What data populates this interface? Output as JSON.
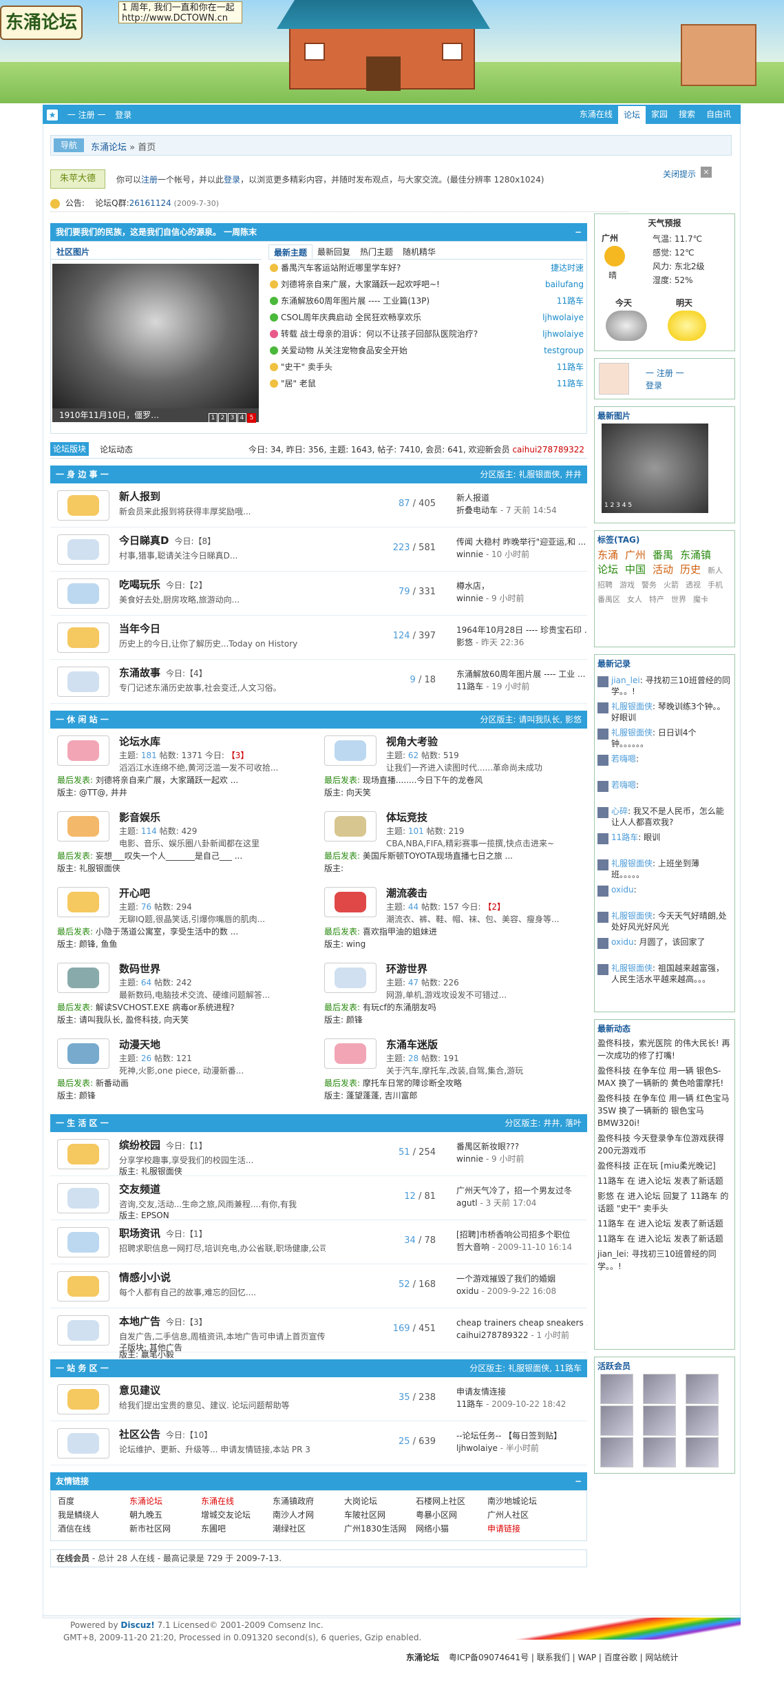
{
  "header": {
    "logo": "东涌论坛",
    "slogan_1": "1 周年, 我们一直和你在一起",
    "slogan_2": "http://www.DCTOWN.cn"
  },
  "nav": {
    "register": "一 注册 一",
    "login": "登录",
    "items": [
      "东涌在线",
      "论坛",
      "家园",
      "搜索",
      "自由讯"
    ]
  },
  "crumb": {
    "nav": "导航",
    "site": "东涌论坛",
    "arrow": "»",
    "home": "首页"
  },
  "welcome": {
    "hello": "朱苹大德",
    "prefix": "你可以",
    "register": "注册",
    "mid": "一个帐号，并以此",
    "login": "登录",
    "suffix": "，以浏览更多精彩内容，并随时发布观点，与大家交流。(最佳分辨率 1280x1024)",
    "close_tip": "关闭提示",
    "close_x": "×"
  },
  "notice": {
    "label": "公告:",
    "text": "论坛Q群:",
    "qq": "26161124",
    "date": "(2009-7-30)"
  },
  "slogan_bar": {
    "text": "我们要我们的民族，这是我们自信心的源泉。 一周陈末",
    "min": "−"
  },
  "photo": {
    "title": "社区图片",
    "caption": "1910年11月10日，僵罗…",
    "nums": [
      "1",
      "2",
      "3",
      "4",
      "5"
    ]
  },
  "thread_tabs": [
    "最新主题",
    "最新回复",
    "热门主题",
    "随机精华"
  ],
  "threads": [
    {
      "title": "番禺汽车客运站附近哪里学车好?",
      "author": "捷达时速"
    },
    {
      "title": "刘德将亲自来广展，大家踊跃一起欢呼吧~!",
      "author": "bailufang"
    },
    {
      "title": "东涌解放60周年图片展 ---- 工业篇(13P)",
      "author": "11路车"
    },
    {
      "title": "CSOL周年庆典启动 全民狂欢畅享欢乐",
      "author": "ljhwolaiye"
    },
    {
      "title": "转载 战士母亲的泪诉：何以不让孩子回部队医院治疗?",
      "author": "ljhwolaiye"
    },
    {
      "title": "关爱动物 从关注宠物食品安全开始",
      "author": "testgroup"
    },
    {
      "title": "\"史干\" 卖手头",
      "author": "11路车"
    },
    {
      "title": "\"居\" 老鼠",
      "author": "11路车"
    }
  ],
  "statbar": {
    "tab1": "论坛版块",
    "tab2": "论坛动态",
    "stats": "今日: 34, 昨日: 356, 主题: 1643, 帖子: 7410, 会员: 641, 欢迎新会员 ",
    "newuser": "caihui278789322"
  },
  "sec1": {
    "title": "一 身 边 事 一",
    "mods": "分区版主: 礼服银面侠, 井井",
    "rows": [
      {
        "name": "新人报到",
        "today": "",
        "desc": "新会员来此报到将获得丰厚奖励哦...",
        "mod": "",
        "topics": "87",
        "posts": "/ 405",
        "last1": "新人报道",
        "last2": "折叠电动车",
        "time": " - 7 天前 14:54"
      },
      {
        "name": "今日睇真D",
        "today": "今日:【8】",
        "desc": "村事,猎事,聪请关注今日睇真D...",
        "mod": "",
        "topics": "223",
        "posts": "/ 581",
        "last1": "传闻 大稳村 昨晚举行\"迎亚运,和 ...",
        "last2": "winnie",
        "time": " - 10 小时前"
      },
      {
        "name": "吃喝玩乐",
        "today": "今日:【2】",
        "desc": "美食好去处,厨房攻略,旅游动向...",
        "mod": "",
        "topics": "79",
        "posts": "/ 331",
        "last1": "樽水店，",
        "last2": "winnie",
        "time": " - 9 小时前"
      },
      {
        "name": "当年今日",
        "today": "",
        "desc": "历史上的今日,让你了解历史...Today on History",
        "mod": "",
        "topics": "124",
        "posts": "/ 397",
        "last1": "1964年10月28日 ---- 珍贵宝石印 ...",
        "last2": "影悠",
        "time": " - 昨天 22:36"
      },
      {
        "name": "东涌故事",
        "today": "今日:【4】",
        "desc": "专门记述东涌历史故事,社会变迁,人文习俗。",
        "mod": "",
        "topics": "9",
        "posts": "/ 18",
        "last1": "东涌解放60周年图片展 ---- 工业 ...",
        "last2": "11路车",
        "time": " - 19 小时前"
      }
    ]
  },
  "sec2": {
    "title": "一 休 闲 站 一",
    "mods": "分区版主: 请叫我队长, 影悠",
    "cells": [
      {
        "name": "论坛水库",
        "topics": "181",
        "posts": "1371",
        "today": "【3】",
        "desc": "滔滔江水连绵不绝,黄河泛滥一发不可收拾...",
        "lp_label": "最后发表:",
        "lp": "刘德将亲自来广展，大家踊跃一起欢 ...",
        "mod": "版主: @TT@, 井井"
      },
      {
        "name": "视角大考验",
        "topics": "62",
        "posts": "519",
        "today": "",
        "desc": "让我们一齐进入读图时代......革命尚未成功",
        "lp_label": "最后发表:",
        "lp": "现场直播........今日下午的龙卷风",
        "mod": "版主: 向天笑"
      },
      {
        "name": "影音娱乐",
        "topics": "114",
        "posts": "429",
        "today": "",
        "desc": "电影、音乐、娱乐圈八卦新闻都在这里",
        "lp_label": "最后发表:",
        "lp": "妄想___叹失一个人_______是自己___ ...",
        "mod": "版主: 礼服银面侠"
      },
      {
        "name": "体坛竞技",
        "topics": "101",
        "posts": "219",
        "today": "",
        "desc": "CBA,NBA,FIFA,精彩赛事一揽撰,快点击进来~",
        "lp_label": "最后发表:",
        "lp": "美国斥斯顿TOYOTA现场直播七日之旅 ...",
        "mod": "版主:"
      },
      {
        "name": "开心吧",
        "topics": "76",
        "posts": "294",
        "today": "",
        "desc": "无聊IQ题,很晶笑话,引爆你嘴唇的肌肉...",
        "lp_label": "最后发表:",
        "lp": "小隐于荡道公寓室，孪受生活中的数 ...",
        "mod": "版主: 颜锋, 鱼鱼"
      },
      {
        "name": "潮流袭击",
        "topics": "44",
        "posts": "157",
        "today": "【2】",
        "desc": "潮流衣、裤、鞋、帽、袜、包、美容、瘦身等...",
        "lp_label": "最后发表:",
        "lp": "喜欢指甲油的姐妹进",
        "mod": "版主: wing"
      },
      {
        "name": "数码世界",
        "topics": "64",
        "posts": "242",
        "today": "",
        "desc": "最新数码,电脑技术交流、硬维问题解答...",
        "lp_label": "最后发表:",
        "lp": "解读SVCHOST.EXE 病毒or系统进程?",
        "mod": "版主: 请叫我队长, 盈佟科技, 向天笑"
      },
      {
        "name": "环游世界",
        "topics": "47",
        "posts": "226",
        "today": "",
        "desc": "网游,单机,游戏攻设发不可错过...",
        "lp_label": "最后发表:",
        "lp": "有玩cf的东涌朋友吗",
        "mod": "版主: 颜锋"
      },
      {
        "name": "动漫天地",
        "topics": "26",
        "posts": "121",
        "today": "",
        "desc": "死神,火影,one piece, 动漫新番...",
        "lp_label": "最后发表:",
        "lp": "新番动画",
        "mod": "版主: 颜锋"
      },
      {
        "name": "东涌车迷版",
        "topics": "28",
        "posts": "191",
        "today": "",
        "desc": "关于汽车,摩托车,改装,自驾,集合,游玩",
        "lp_label": "最后发表:",
        "lp": "摩托车日常的障诊断全攻略",
        "mod": "版主: 蓬望蓬蓬, 吉川富郎"
      }
    ]
  },
  "sec3": {
    "title": "一 生 活 区 一",
    "mods": "分区版主: 井井, 落叶",
    "rows": [
      {
        "name": "缤纷校园",
        "today": "今日:【1】",
        "desc": "分享学校趣事,享受我们的校园生活...",
        "mod": "版主: 礼服银面侠",
        "topics": "51",
        "posts": "/ 254",
        "last1": "番禺区新妆眼???",
        "last2": "winnie",
        "time": " - 9 小时前"
      },
      {
        "name": "交友频道",
        "today": "",
        "desc": "咨询,交友,活动...生命之旅,风雨兼程....有你,有我",
        "mod": "版主: EPSON",
        "topics": "12",
        "posts": "/ 81",
        "last1": "广州天气冷了，招一个男友过冬",
        "last2": "agutl",
        "time": " - 3 天前 17:04"
      },
      {
        "name": "职场资讯",
        "today": "今日:【1】",
        "desc": "招聘求职信息一网打尽,培训充电,办公省联,职场健康,公司趣事...",
        "mod": "",
        "topics": "34",
        "posts": "/ 78",
        "last1": "[招聘]市桥香响公司招多个职位",
        "last2": "哲大音响",
        "time": " - 2009-11-10 16:14"
      },
      {
        "name": "情感小小说",
        "today": "",
        "desc": "每个人都有自己的故事,难忘的回忆....",
        "mod": "",
        "topics": "52",
        "posts": "/ 168",
        "last1": "一个游戏摧毁了我们的婚姻",
        "last2": "oxidu",
        "time": " - 2009-9-22 16:08"
      },
      {
        "name": "本地广告",
        "today": "今日:【3】",
        "desc": "自发广告,二手信息,周植资讯,本地广告可申请上首页宣传.",
        "mod2": "子版块: 其他广告",
        "mod": "版主: 嬴笔小毅",
        "topics": "169",
        "posts": "/ 451",
        "last1": "cheap trainers cheap sneakers ...",
        "last2": "caihui278789322",
        "time": " - 1 小时前"
      }
    ]
  },
  "sec4": {
    "title": "一 站 务 区 一",
    "mods": "分区版主: 礼服银面侠, 11路车",
    "rows": [
      {
        "name": "意见建议",
        "today": "",
        "desc": "给我们提出宝贵的意见、建议. 论坛问题帮助等",
        "mod": "",
        "topics": "35",
        "posts": "/ 238",
        "last1": "申请友情连接",
        "last2": "11路车",
        "time": " - 2009-10-22 18:42"
      },
      {
        "name": "社区公告",
        "today": "今日:【10】",
        "desc": "论坛维护、更新、升级等... 申请友情链接,本站 PR 3",
        "mod": "",
        "topics": "25",
        "posts": "/ 639",
        "last1": "--论坛任务-- 【每日签到贴】",
        "last2": "ljhwolaiye",
        "time": " - 半小时前"
      }
    ]
  },
  "friends": {
    "title": "友情链接",
    "min": "−",
    "items": [
      "百度",
      "东涌论坛",
      "东涌在线",
      "东涌镇政府",
      "大岗论坛",
      "石楼网上社区",
      "南沙地城论坛",
      "我是鳞绕人",
      "朝九晚五",
      "增城交友论坛",
      "南沙人才网",
      "车陂社区网",
      "粤暴小区网",
      "广州人社区",
      "酒信在线",
      "新市社区网",
      "东圃吧",
      "潮绿社区",
      "广州1830生活网",
      "网络小猫",
      "申请链接"
    ],
    "red": [
      1,
      2,
      20
    ]
  },
  "online": {
    "label": "在线会员",
    "text": " - 总计 28 人在线 - 最高记录是 729 于 2009-7-13."
  },
  "weather": {
    "title": "天气预报",
    "city": "广州",
    "cond": "晴",
    "temp": "气温: 11.7℃",
    "feel": "感觉: 12℃",
    "wind": "风力: 东北2级",
    "hum": "湿度: 52%",
    "today": "今天",
    "tomorrow": "明天"
  },
  "user": {
    "register": "一 注册 一",
    "login": "登录"
  },
  "newpic": {
    "title": "最新图片",
    "nums": "1 2 3 4 5"
  },
  "tags": {
    "title": "标签(TAG)",
    "items": [
      "东涌",
      "广州",
      "番禺",
      "东涌镇",
      "论坛",
      "中国",
      "活动",
      "历史",
      "新人",
      "招聘",
      "游戏",
      "警务",
      "火箭",
      "透视",
      "手机",
      "番禺区",
      "女人",
      "特产",
      "世界",
      "魔卡"
    ]
  },
  "records": {
    "title": "最新记录",
    "items": [
      {
        "u": "jian_lei",
        "t": ": 寻找初三10班曾经的同学。。!"
      },
      {
        "u": "礼服银面侠",
        "t": ": 琴晚训练3个钟。。好眼训"
      },
      {
        "u": "礼服银面侠",
        "t": ": 日日训4个钟。。。。。。"
      },
      {
        "u": "若嗨嗯",
        "t": ":"
      },
      {
        "u": "若嗨嗯",
        "t": ":"
      },
      {
        "u": "心碎",
        "t": ": 我又不是人民币，怎么能让人人都喜欢我?"
      },
      {
        "u": "11路车",
        "t": ": 眼训"
      },
      {
        "u": "礼服银面侠",
        "t": ": 上班坐到薄班。。。。。"
      },
      {
        "u": "oxidu",
        "t": ":"
      },
      {
        "u": "礼服银面侠",
        "t": ": 今天天气好晴朗,处处好风光好风光"
      },
      {
        "u": "oxidu",
        "t": ": 月圆了，该回家了"
      },
      {
        "u": "礼服银面侠",
        "t": ": 祖国越来越富强，人民生活水平越来越高。。。"
      }
    ]
  },
  "events": {
    "title": "最新动态",
    "items": [
      "盈佟科技，索光医院 的伟大民长! 再一次成功的修了打嘴!",
      "盈佟科技 在争车位 用一辆 银色S-MAX 换了一辆新的 黄色哈雷摩托!",
      "盈佟科技 在争车位 用一辆 红色宝马3SW 换了一辆新的 银色宝马BMW320i!",
      "盈佟科技 今天登录争车位游戏获得200元游戏币",
      "盈佟科技 正在玩 [miu柔光晚记]",
      "11路车 在 进入论坛 发表了新话题",
      "影悠 在 进入论坛 回复了 11路车 的话题 \"史干\" 卖手头",
      "11路车 在 进入论坛 发表了新话题",
      "11路车 在 进入论坛 发表了新话题",
      "jian_lei: 寻找初三10班曾经的同学。。!"
    ]
  },
  "members": {
    "title": "活跃会员"
  },
  "footer": {
    "powered": "Powered by ",
    "discuz": "Discuz!",
    "lic": " 7.1 Licensed© 2001-2009 Comsenz Inc.",
    "gmt": "GMT+8, 2009-11-20 21:20, Processed in 0.091320 second(s), 6 queries, Gzip enabled.",
    "links": [
      "东涌论坛",
      "粤ICP备09074641号",
      "联系我们",
      "WAP",
      "百度谷歌",
      "网站统计"
    ]
  },
  "colors": {
    "accent": "#2e9fd8",
    "red": "#cc0000"
  }
}
